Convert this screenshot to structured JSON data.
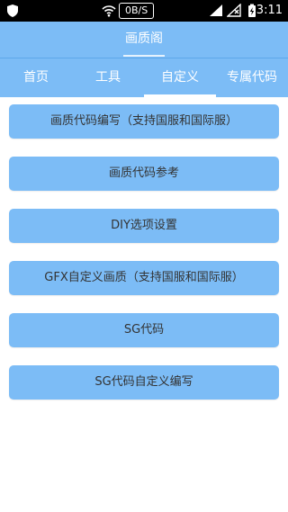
{
  "status_bar": {
    "network_speed": "0B/S",
    "time": "3:11",
    "icons": [
      "shield-icon",
      "wifi-icon",
      "signal-icon",
      "no-sim-icon",
      "battery-charging-icon"
    ]
  },
  "header": {
    "title": "画质阁"
  },
  "tabs": [
    {
      "label": "首页",
      "active": false
    },
    {
      "label": "工具",
      "active": false
    },
    {
      "label": "自定义",
      "active": true
    },
    {
      "label": "专属代码",
      "active": false
    }
  ],
  "buttons": [
    "画质代码编写（支持国服和国际服）",
    "画质代码参考",
    "DIY选项设置",
    "GFX自定义画质（支持国服和国际服）",
    "SG代码",
    "SG代码自定义编写"
  ],
  "colors": {
    "accent": "#7cbcf6",
    "text": "#333333"
  }
}
